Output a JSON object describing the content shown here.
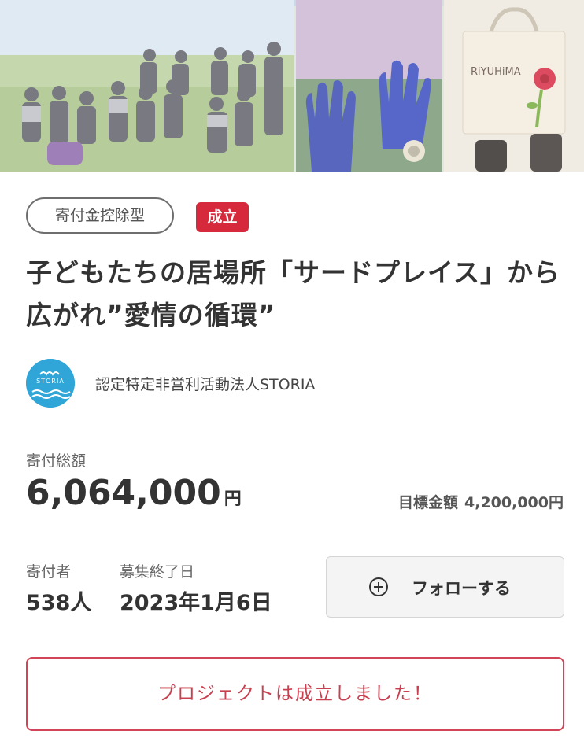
{
  "hero": {
    "bag_text": "RiYUHiMA"
  },
  "tags": {
    "deduction": "寄付金控除型",
    "status": "成立"
  },
  "project": {
    "title": "子どもたちの居場所「サードプレイス」から広がれ”愛情の循環”"
  },
  "organization": {
    "logo_text": "STORIA",
    "name": "認定特定非営利活動法人STORIA"
  },
  "funding": {
    "total_label": "寄付総額",
    "total_value": "6,064,000",
    "currency": "円",
    "goal_label": "目標金額",
    "goal_value": "4,200,000円"
  },
  "stats": {
    "donors_label": "寄付者",
    "donors_value": "538人",
    "end_label": "募集終了日",
    "end_value": "2023年1月6日"
  },
  "follow": {
    "icon": "plus-circle-icon",
    "label": "フォローする"
  },
  "result": {
    "message": "プロジェクトは成立しました！"
  },
  "colors": {
    "accent_red": "#d6293c",
    "success_border": "#d24457",
    "logo_blue": "#2fa6d7"
  }
}
